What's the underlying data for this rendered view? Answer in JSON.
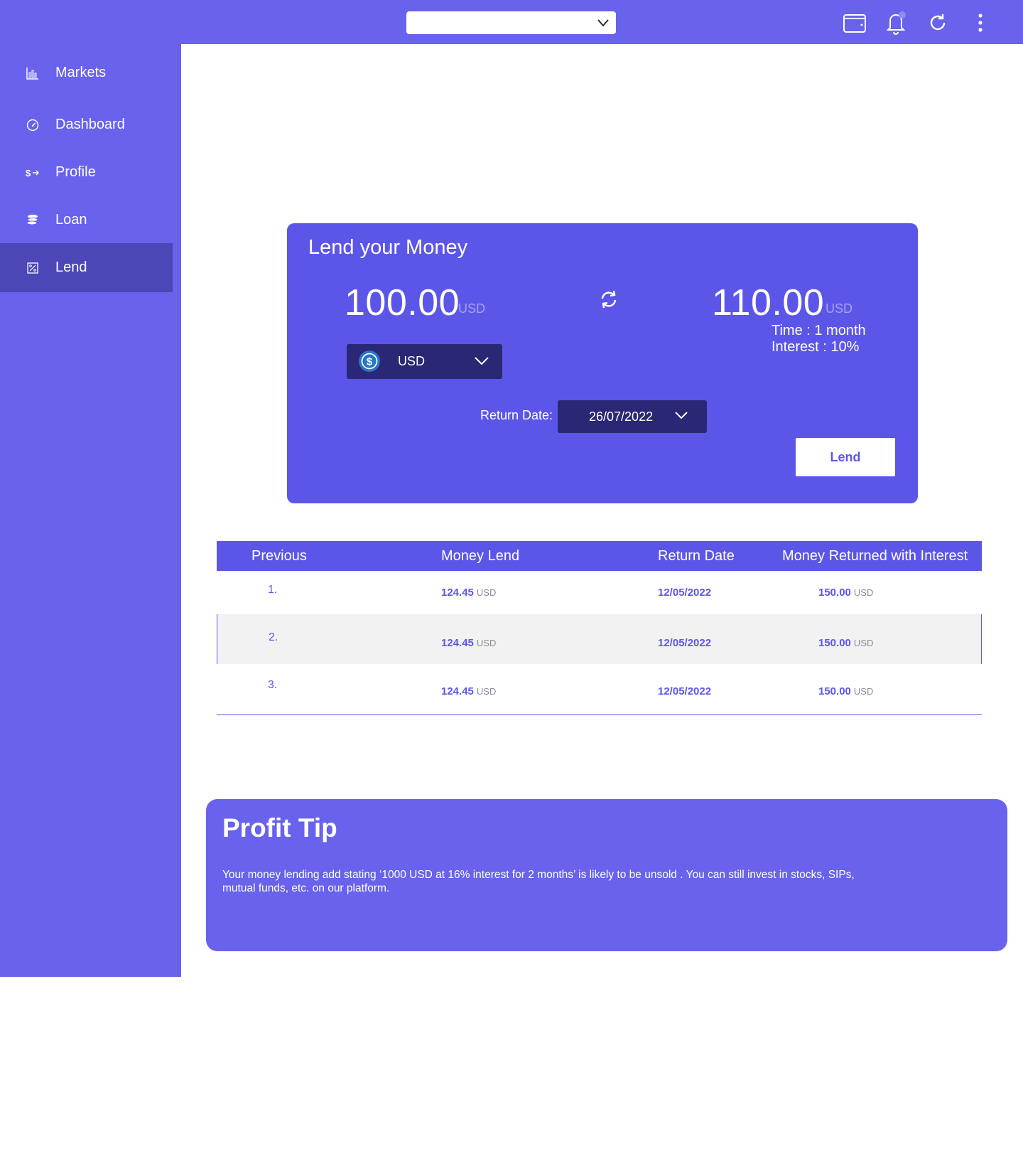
{
  "topbar": {
    "select_value": "",
    "icons": [
      "wallet-icon",
      "bell-icon",
      "refresh-icon",
      "more-vertical-icon"
    ]
  },
  "sidebar": {
    "items": [
      {
        "label": "Markets",
        "icon": "bar-chart-icon"
      },
      {
        "label": "Dashboard",
        "icon": "gauge-icon"
      },
      {
        "label": "Profile",
        "icon": "dollar-exchange-icon"
      },
      {
        "label": "Loan",
        "icon": "coins-icon"
      },
      {
        "label": "Lend",
        "icon": "percent-icon",
        "active": true
      }
    ]
  },
  "lend": {
    "title": "Lend your Money",
    "amount": "100.00",
    "amount_unit": "USD",
    "return_amount": "110.00",
    "return_unit": "USD",
    "time": "Time : 1 month",
    "interest": "Interest : 10%",
    "currency": "USD",
    "return_date_label": "Return Date:",
    "return_date": "26/07/2022",
    "button": "Lend"
  },
  "table": {
    "headers": [
      "Previous",
      "Money Lend",
      "Return Date",
      "Money Returned with Interest"
    ],
    "rows": [
      {
        "index": "1.",
        "money": "124.45",
        "money_unit": "USD",
        "date": "12/05/2022",
        "returned": "150.00",
        "returned_unit": "USD"
      },
      {
        "index": "2.",
        "money": "124.45",
        "money_unit": "USD",
        "date": "12/05/2022",
        "returned": "150.00",
        "returned_unit": "USD"
      },
      {
        "index": "3.",
        "money": "124.45",
        "money_unit": "USD",
        "date": "12/05/2022",
        "returned": "150.00",
        "returned_unit": "USD"
      }
    ]
  },
  "tip": {
    "title": "Profit Tip",
    "text": "Your money lending add stating ‘1000 USD at 16% interest for 2 months’ is likely to be unsold . You can still invest in stocks, SIPs, mutual funds, etc. on our platform."
  },
  "colors": {
    "primary": "#6862ec",
    "card": "#5c56e8",
    "dark": "#2a2775",
    "active": "#4b47b6"
  }
}
